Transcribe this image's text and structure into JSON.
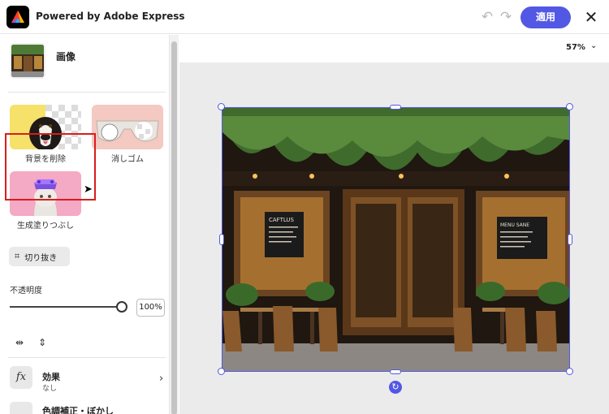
{
  "header": {
    "app_title": "Powered by Adobe Express",
    "apply_label": "適用",
    "undo_icon": "undo-icon",
    "redo_icon": "redo-icon",
    "close_icon": "close-icon"
  },
  "sidebar": {
    "section_title": "画像",
    "tools": [
      {
        "label": "背景を削除",
        "icon": "dog-remove-bg"
      },
      {
        "label": "消しゴム",
        "icon": "glasses-eraser"
      },
      {
        "label": "生成塗りつぶし",
        "icon": "cat-generative-fill"
      }
    ],
    "crop_label": "切り抜き",
    "opacity_label": "不透明度",
    "opacity_value": "100%",
    "opacity_level": 1.0,
    "effects": {
      "title": "効果",
      "subtitle": "なし"
    },
    "adjustments": {
      "title": "色調補正・ぼかし"
    }
  },
  "canvas": {
    "zoom": "57%",
    "photo_signs": {
      "left_menu": "CAFTLUS",
      "right_menu": "MENU SANE"
    }
  },
  "colors": {
    "accent": "#5258e4",
    "highlight_red": "#d81d1d"
  }
}
